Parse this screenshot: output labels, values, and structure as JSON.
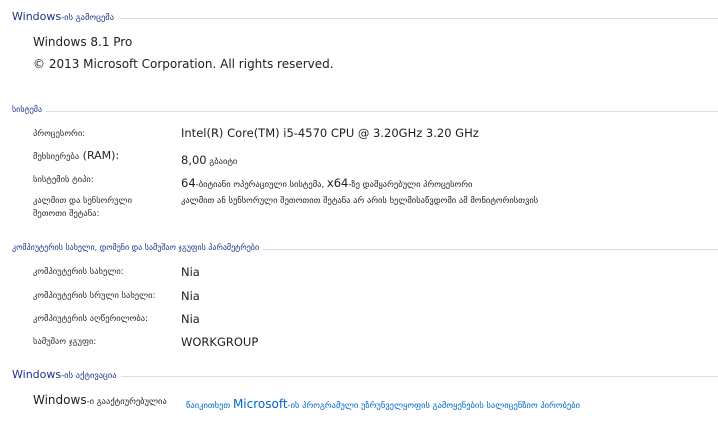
{
  "windows_edition": {
    "header_prefix": "Windows",
    "header_suffix": "-ის გამოცემა",
    "edition": "Windows 8.1 Pro",
    "copyright": "© 2013 Microsoft Corporation. All rights reserved."
  },
  "system": {
    "header": "სისტემა",
    "processor_label": "პროცესორი:",
    "processor_value": "Intel(R) Core(TM) i5-4570 CPU @ 3.20GHz   3.20 GHz",
    "ram_label_ka": "მეხსიერება",
    "ram_label_en": " (RAM):",
    "ram_value_num": "8,00",
    "ram_value_unit": " გბაიტი",
    "type_label": "სისტემის ტიპი:",
    "type_value_a": "64",
    "type_value_b": "-ბიტიანი ოპერაციული სისტემა, ",
    "type_value_c": "x64",
    "type_value_d": "-ზე დამყარებული პროცესორი",
    "pen_label_line1": "კალმით და სენსორული",
    "pen_label_line2": "შეთოთი შეტანა:",
    "pen_value": "კალმით ან სენსორული შეთოთით შეტანა არ არის ხელმისაწვდომი ამ მონიტორისთვის"
  },
  "computer_name": {
    "header": "კომპიუტერის სახელი, დომენი და სამუშაო ჯგუფის პარამეტრები",
    "name_label": "კომპიუტერის სახელი:",
    "name_value": "Nia",
    "full_name_label": "კომპიუტერის სრული სახელი:",
    "full_name_value": "Nia",
    "description_label": "კომპიუტერის აღწერილობა:",
    "description_value": "Nia",
    "workgroup_label": "სამუშაო ჯგუფი:",
    "workgroup_value": "WORKGROUP"
  },
  "activation": {
    "header_prefix": "Windows",
    "header_suffix": "-ის აქტივაცია",
    "status_prefix": "Windows",
    "status_suffix": "-ი გააქტიურებულია",
    "link_a": "წაიკითხეთ ",
    "link_b": "Microsoft",
    "link_c": "-ის პროგრამული უზრუნველყოფის გამოყენების სალიცენზიო პირობები"
  }
}
